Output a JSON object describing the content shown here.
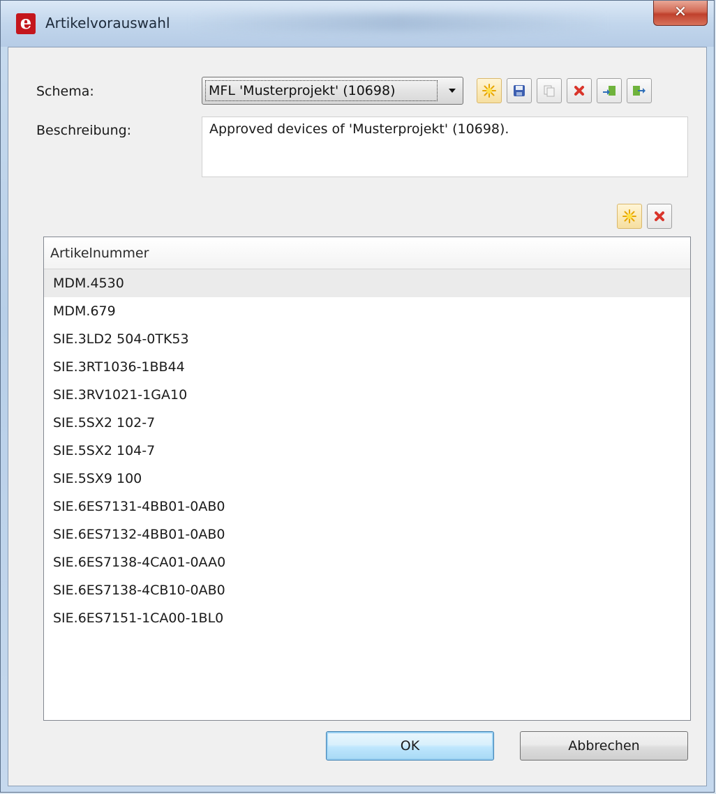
{
  "window": {
    "title": "Artikelvorauswahl",
    "logo_letter": "e",
    "close_glyph": "✕"
  },
  "form": {
    "schema_label": "Schema:",
    "schema_value": "MFL 'Musterprojekt' (10698)",
    "description_label": "Beschreibung:",
    "description_value": "Approved devices of 'Musterprojekt' (10698)."
  },
  "toolbar": {
    "icons": [
      "new-icon",
      "save-icon",
      "copy-icon",
      "delete-icon",
      "import-icon",
      "export-icon"
    ]
  },
  "list_toolbar": {
    "icons": [
      "add-icon",
      "remove-icon"
    ]
  },
  "list": {
    "column_header": "Artikelnummer",
    "rows": [
      "MDM.4530",
      "MDM.679",
      "SIE.3LD2 504-0TK53",
      "SIE.3RT1036-1BB44",
      "SIE.3RV1021-1GA10",
      "SIE.5SX2 102-7",
      "SIE.5SX2 104-7",
      "SIE.5SX9 100",
      "SIE.6ES7131-4BB01-0AB0",
      "SIE.6ES7132-4BB01-0AB0",
      "SIE.6ES7138-4CA01-0AA0",
      "SIE.6ES7138-4CB10-0AB0",
      "SIE.6ES7151-1CA00-1BL0"
    ],
    "selected_index": 0
  },
  "buttons": {
    "ok_label": "OK",
    "cancel_label": "Abbrechen"
  },
  "colors": {
    "accent": "#3c7fb1",
    "close": "#c0402c",
    "logo": "#c4161c"
  }
}
